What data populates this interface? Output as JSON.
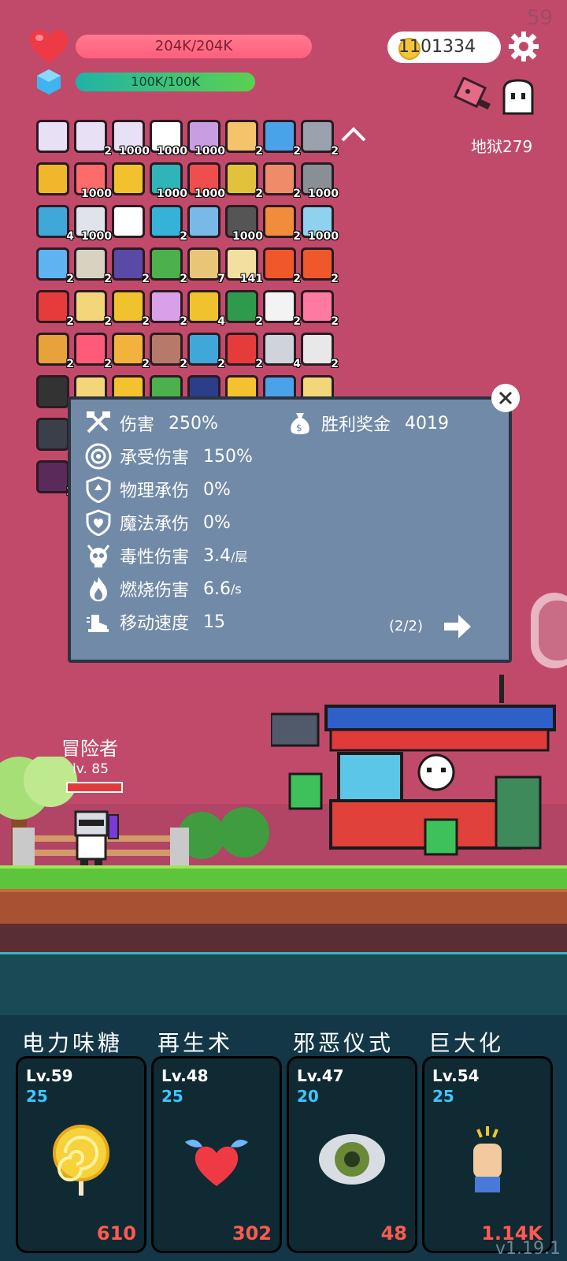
{
  "fps": "59",
  "hud": {
    "hp_text": "204K/204K",
    "mp_text": "100K/100K",
    "coins": "1101334",
    "stage": "地狱279"
  },
  "inventory": [
    {
      "icon": "scroll-icon",
      "count": "",
      "color": "#e8e1f6"
    },
    {
      "icon": "scroll-icon",
      "count": "2",
      "color": "#e8e1f6"
    },
    {
      "icon": "scroll-icon",
      "count": "1000",
      "color": "#e8e1f6"
    },
    {
      "icon": "ghost-icon",
      "count": "1000",
      "color": "#ffffff"
    },
    {
      "icon": "flower-icon",
      "count": "1000",
      "color": "#c89de2"
    },
    {
      "icon": "atom-icon",
      "count": "2",
      "color": "#f3c46b"
    },
    {
      "icon": "star-card-icon",
      "count": "2",
      "color": "#4aa2e8"
    },
    {
      "icon": "axe-icon",
      "count": "2",
      "color": "#9aa3ad"
    },
    {
      "icon": "crown-icon",
      "count": "",
      "color": "#f0b72c"
    },
    {
      "icon": "jar-icon",
      "count": "1000",
      "color": "#ff6b6b"
    },
    {
      "icon": "coin-stack-icon",
      "count": "",
      "color": "#f2c12e"
    },
    {
      "icon": "disc-icon",
      "count": "1000",
      "color": "#2fb5b7"
    },
    {
      "icon": "heart-icon",
      "count": "1000",
      "color": "#ef4e4e"
    },
    {
      "icon": "egg-icon",
      "count": "2",
      "color": "#e2c23c"
    },
    {
      "icon": "comet-icon",
      "count": "2",
      "color": "#f08b6a"
    },
    {
      "icon": "spiked-ball-icon",
      "count": "1000",
      "color": "#8a8f96"
    },
    {
      "icon": "cycle-icon",
      "count": "4",
      "color": "#3fa8d8"
    },
    {
      "icon": "card-icon",
      "count": "1000",
      "color": "#dfe3ea"
    },
    {
      "icon": "flag-icon",
      "count": "",
      "color": "#ffffff"
    },
    {
      "icon": "portal-icon",
      "count": "2",
      "color": "#34b2d8"
    },
    {
      "icon": "shirt-icon",
      "count": "",
      "color": "#78b9e8"
    },
    {
      "icon": "camera-icon",
      "count": "1000",
      "color": "#555555"
    },
    {
      "icon": "briefcase-icon",
      "count": "2",
      "color": "#f08c3a"
    },
    {
      "icon": "cloud-icon",
      "count": "1000",
      "color": "#8fd2f0"
    },
    {
      "icon": "sword-icon",
      "count": "2",
      "color": "#5fb3f0"
    },
    {
      "icon": "compass-icon",
      "count": "2",
      "color": "#d8d2c0"
    },
    {
      "icon": "wizard-hat-icon",
      "count": "2",
      "color": "#5a4aa8"
    },
    {
      "icon": "cash-icon",
      "count": "2",
      "color": "#4cb04c"
    },
    {
      "icon": "map-icon",
      "count": "7",
      "color": "#e9c677"
    },
    {
      "icon": "book-icon",
      "count": "141",
      "color": "#f3e0a0"
    },
    {
      "icon": "fire-icon",
      "count": "2",
      "color": "#f0582c"
    },
    {
      "icon": "flame-ring-icon",
      "count": "2",
      "color": "#f0582c"
    },
    {
      "icon": "thermometer-icon",
      "count": "2",
      "color": "#e53b3b"
    },
    {
      "icon": "note-icon",
      "count": "2",
      "color": "#f3d57a"
    },
    {
      "icon": "pineapple-icon",
      "count": "2",
      "color": "#f0c22e"
    },
    {
      "icon": "unicorn-icon",
      "count": "2",
      "color": "#d8a0e8"
    },
    {
      "icon": "ring-icon",
      "count": "4",
      "color": "#f0c22e"
    },
    {
      "icon": "snake-icon",
      "count": "2",
      "color": "#2f9a4c"
    },
    {
      "icon": "envelope-icon",
      "count": "2",
      "color": "#f3f3f3"
    },
    {
      "icon": "ice-cream-icon",
      "count": "2",
      "color": "#ff7aa3"
    },
    {
      "icon": "tome-icon",
      "count": "2",
      "color": "#e8a23c"
    },
    {
      "icon": "drop-icon",
      "count": "2",
      "color": "#ff5a7a"
    },
    {
      "icon": "beer-icon",
      "count": "2",
      "color": "#f3b23c"
    },
    {
      "icon": "tombstone-icon",
      "count": "2",
      "color": "#b77a6a"
    },
    {
      "icon": "snowflake-icon",
      "count": "2",
      "color": "#3fa8d8"
    },
    {
      "icon": "mushroom-icon",
      "count": "2",
      "color": "#e53b3b"
    },
    {
      "icon": "hook-icon",
      "count": "4",
      "color": "#cfd4da"
    },
    {
      "icon": "bulb-icon",
      "count": "2",
      "color": "#e8e8e8"
    },
    {
      "icon": "bomb-icon",
      "count": "",
      "color": "#333333"
    },
    {
      "icon": "parchment-icon",
      "count": "",
      "color": "#f3d57a"
    },
    {
      "icon": "sun-icon",
      "count": "",
      "color": "#f3c22e"
    },
    {
      "icon": "vine-icon",
      "count": "",
      "color": "#4cb04c"
    },
    {
      "icon": "bible-icon",
      "count": "",
      "color": "#2a3e8a"
    },
    {
      "icon": "burst-icon",
      "count": "",
      "color": "#f3c22e"
    },
    {
      "icon": "paper-icon",
      "count": "",
      "color": "#4aa2e8"
    },
    {
      "icon": "question-scroll-icon",
      "count": "",
      "color": "#f3d57a"
    },
    {
      "icon": "skull-book-icon",
      "count": "",
      "color": "#3a3f4a"
    },
    {
      "icon": "purple-book-icon",
      "count": "2",
      "color": "#5a2a5a"
    }
  ],
  "stats_panel": {
    "left": [
      {
        "icon": "crossed-axes-icon",
        "label": "伤害",
        "value": "250%"
      },
      {
        "icon": "target-icon",
        "label": "承受伤害",
        "value": "150%"
      },
      {
        "icon": "shield-icon",
        "label": "物理承伤",
        "value": "0%"
      },
      {
        "icon": "heart-shield-icon",
        "label": "魔法承伤",
        "value": "0%"
      },
      {
        "icon": "poison-skull-icon",
        "label": "毒性伤害",
        "value": "3.4",
        "unit": "/层"
      },
      {
        "icon": "flame-icon",
        "label": "燃烧伤害",
        "value": "6.6",
        "unit": "/s"
      },
      {
        "icon": "boot-icon",
        "label": "移动速度",
        "value": "15"
      }
    ],
    "right": [
      {
        "icon": "money-bag-icon",
        "label": "胜利奖金",
        "value": "4019"
      }
    ],
    "pager": "(2/2)"
  },
  "scene": {
    "hero_name": "冒险者",
    "hero_level": "lv. 85"
  },
  "skills": [
    {
      "name": "电力味糖",
      "level": "Lv.59",
      "sub": "25",
      "cost": "610",
      "icon": "lollipop-icon"
    },
    {
      "name": "再生术",
      "level": "Lv.48",
      "sub": "25",
      "cost": "302",
      "icon": "winged-heart-icon"
    },
    {
      "name": "邪恶仪式",
      "level": "Lv.47",
      "sub": "20",
      "cost": "48",
      "icon": "eye-icon"
    },
    {
      "name": "巨大化",
      "level": "Lv.54",
      "sub": "25",
      "cost": "1.14K",
      "icon": "fist-icon"
    }
  ],
  "version": "v1.19.1"
}
